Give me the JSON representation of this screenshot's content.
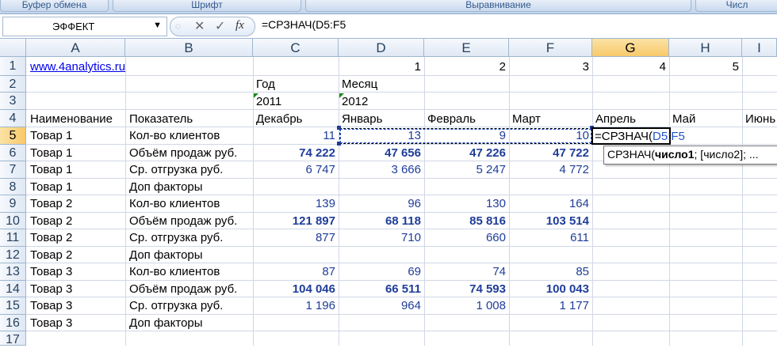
{
  "ribbon": {
    "groups": [
      "Буфер обмена",
      "Шрифт",
      "Выравнивание",
      "Числ"
    ]
  },
  "formula_bar": {
    "name_box": "ЭФФЕКТ",
    "cancel_icon": "✕",
    "enter_icon": "✓",
    "fx_label": "fx",
    "formula": "=СРЗНАЧ(D5:F5"
  },
  "columns": [
    "A",
    "B",
    "C",
    "D",
    "E",
    "F",
    "G",
    "H",
    "I"
  ],
  "rows": [
    "1",
    "2",
    "3",
    "4",
    "5",
    "6",
    "7",
    "8",
    "9",
    "10",
    "11",
    "12",
    "13",
    "14",
    "15",
    "16",
    "17"
  ],
  "sheet": {
    "A1": "www.4analytics.ru",
    "D1": "1",
    "E1": "2",
    "F1": "3",
    "G1": "4",
    "H1": "5",
    "C2": "Год",
    "D2": "Месяц",
    "C3": "2011",
    "D3": "2012",
    "A4": "Наименование",
    "B4": "Показатель",
    "C4": "Декабрь",
    "D4": "Январь",
    "E4": "Февраль",
    "F4": "Март",
    "G4": "Апрель",
    "H4": "Май",
    "I4": "Июнь",
    "A5": "Товар 1",
    "B5": "Кол-во клиентов",
    "C5": "11",
    "D5": "13",
    "E5": "9",
    "F5": "10",
    "A6": "Товар 1",
    "B6": "Объём продаж руб.",
    "C6": "74 222",
    "D6": "47 656",
    "E6": "47 226",
    "F6": "47 722",
    "A7": "Товар 1",
    "B7": "Ср. отгрузка руб.",
    "C7": "6 747",
    "D7": "3 666",
    "E7": "5 247",
    "F7": "4 772",
    "A8": "Товар 1",
    "B8": "Доп факторы",
    "A9": "Товар 2",
    "B9": "Кол-во клиентов",
    "C9": "139",
    "D9": "96",
    "E9": "130",
    "F9": "164",
    "A10": "Товар 2",
    "B10": "Объём продаж руб.",
    "C10": "121 897",
    "D10": "68 118",
    "E10": "85 816",
    "F10": "103 514",
    "A11": "Товар 2",
    "B11": "Ср. отгрузка руб.",
    "C11": "877",
    "D11": "710",
    "E11": "660",
    "F11": "611",
    "A12": "Товар 2",
    "B12": "Доп факторы",
    "A13": "Товар 3",
    "B13": "Кол-во клиентов",
    "C13": "87",
    "D13": "69",
    "E13": "74",
    "F13": "85",
    "A14": "Товар 3",
    "B14": "Объём продаж руб.",
    "C14": "104 046",
    "D14": "66 511",
    "E14": "74 593",
    "F14": "100 043",
    "A15": "Товар 3",
    "B15": "Ср. отгрузка руб.",
    "C15": "1 196",
    "D15": "964",
    "E15": "1 008",
    "F15": "1 177",
    "A16": "Товар 3",
    "B16": "Доп факторы"
  },
  "editing": {
    "cell": "G5",
    "fn": "=СРЗНАЧ(",
    "ref": "D5:F5"
  },
  "tooltip": {
    "fn": "СРЗНАЧ(",
    "arg1": "число1",
    "rest": "; [число2]; ..."
  },
  "colors": {
    "accent": "#1f3d99",
    "link": "#0000ee",
    "selected_header": "#f8c96a"
  }
}
